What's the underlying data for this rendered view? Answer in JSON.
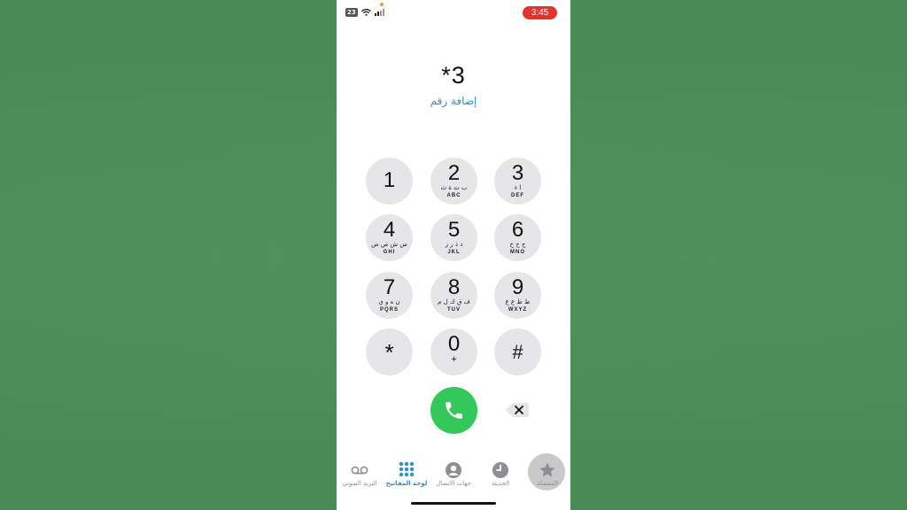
{
  "status_bar": {
    "battery_level": "23",
    "time": "3:45",
    "time_pill_color": "#e5332a"
  },
  "dialer": {
    "entered_number": "*3",
    "add_number_label": "إضافة رقم"
  },
  "keypad": [
    {
      "digit": "1",
      "arabic": "",
      "latin": ""
    },
    {
      "digit": "2",
      "arabic": "ب ت ة ث",
      "latin": "ABC"
    },
    {
      "digit": "3",
      "arabic": "ا ء",
      "latin": "DEF"
    },
    {
      "digit": "4",
      "arabic": "س ش ص ض",
      "latin": "GHI"
    },
    {
      "digit": "5",
      "arabic": "د ذ ر ز",
      "latin": "JKL"
    },
    {
      "digit": "6",
      "arabic": "ج ح خ",
      "latin": "MNO"
    },
    {
      "digit": "7",
      "arabic": "ن ه و ي",
      "latin": "PQRS"
    },
    {
      "digit": "8",
      "arabic": "ف ق ك ل م",
      "latin": "TUV"
    },
    {
      "digit": "9",
      "arabic": "ط ظ ع غ",
      "latin": "WXYZ"
    },
    {
      "digit": "*",
      "arabic": "",
      "latin": ""
    },
    {
      "digit": "0",
      "arabic": "",
      "latin": "+"
    },
    {
      "digit": "#",
      "arabic": "",
      "latin": ""
    }
  ],
  "actions": {
    "call_icon": "phone-icon",
    "call_color": "#34c759",
    "delete_icon": "backspace-icon"
  },
  "tabs": [
    {
      "label": "البريد الصوتي",
      "icon": "voicemail-icon",
      "active": false
    },
    {
      "label": "لوحة المفاتيح",
      "icon": "keypad-icon",
      "active": true
    },
    {
      "label": "جهات الاتصال",
      "icon": "contacts-icon",
      "active": false
    },
    {
      "label": "الحديثة",
      "icon": "clock-icon",
      "active": false
    },
    {
      "label": "المفضلة",
      "icon": "star-icon",
      "active": false
    }
  ],
  "accent_color": "#2c8fd6"
}
